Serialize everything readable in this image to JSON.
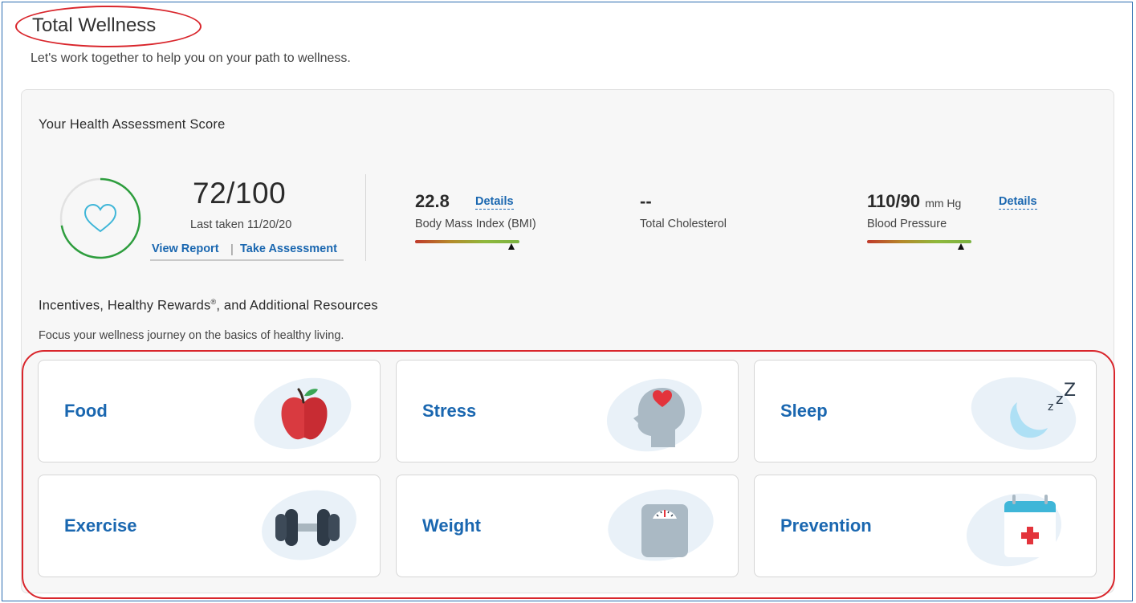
{
  "header": {
    "title": "Total Wellness",
    "subtitle": "Let's work together to help you on your path to wellness."
  },
  "assessment": {
    "heading": "Your Health Assessment Score",
    "score": "72/100",
    "score_fraction": 0.72,
    "last_taken": "Last taken 11/20/20",
    "view_report": "View Report",
    "separator": "|",
    "take_assessment": "Take Assessment",
    "heart_icon": "heart-icon",
    "ring_color": "#2e9e3e"
  },
  "metrics": {
    "bmi": {
      "value": "22.8",
      "details": "Details",
      "label": "Body Mass Index (BMI)",
      "gauge_position": 0.92
    },
    "cholesterol": {
      "value": "--",
      "label": "Total Cholesterol"
    },
    "blood_pressure": {
      "value": "110/90",
      "unit": "mm Hg",
      "details": "Details",
      "label": "Blood Pressure",
      "gauge_position": 0.9
    }
  },
  "incentives": {
    "heading": "Incentives, Healthy Rewards",
    "heading_mark": "®",
    "heading_tail": ", and Additional Resources",
    "description": "Focus your wellness journey on the basics of healthy living."
  },
  "cards": [
    {
      "label": "Food",
      "icon": "apple-icon"
    },
    {
      "label": "Stress",
      "icon": "head-heart-icon"
    },
    {
      "label": "Sleep",
      "icon": "moon-zzz-icon"
    },
    {
      "label": "Exercise",
      "icon": "dumbbell-icon"
    },
    {
      "label": "Weight",
      "icon": "scale-icon"
    },
    {
      "label": "Prevention",
      "icon": "medical-calendar-icon"
    }
  ],
  "colors": {
    "accent_link": "#1a67b0",
    "annotation_red": "#d9262c",
    "frame_blue": "#2b6cb0"
  }
}
